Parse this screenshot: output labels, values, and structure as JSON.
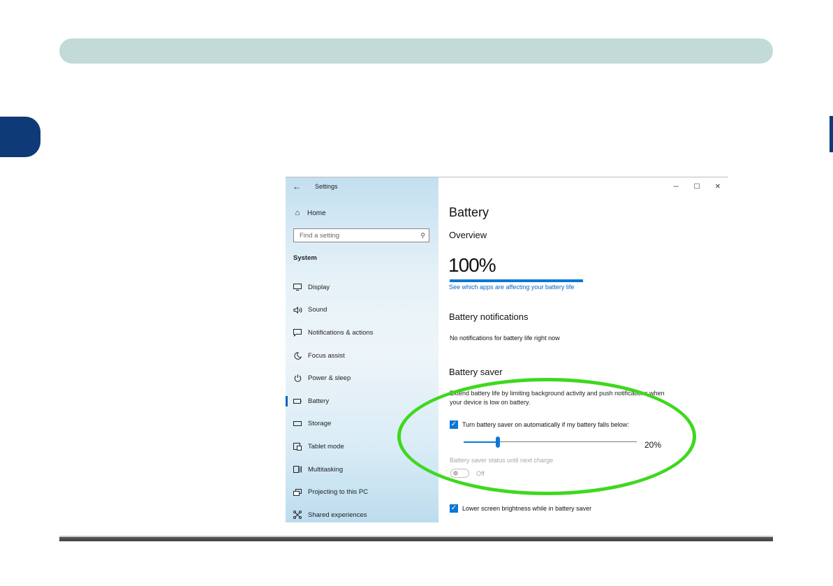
{
  "window": {
    "app_title": "Settings",
    "back_icon": "←",
    "minimize_icon": "─",
    "maximize_icon": "☐",
    "close_icon": "✕"
  },
  "nav": {
    "home_label": "Home",
    "home_icon": "⌂",
    "search": {
      "placeholder": "Find a setting",
      "value": "",
      "icon": "⚲"
    },
    "section_label": "System",
    "items": [
      {
        "label": "Display",
        "icon": "display-icon",
        "active": false
      },
      {
        "label": "Sound",
        "icon": "sound-icon",
        "active": false
      },
      {
        "label": "Notifications & actions",
        "icon": "notifications-icon",
        "active": false
      },
      {
        "label": "Focus assist",
        "icon": "focus-assist-icon",
        "active": false
      },
      {
        "label": "Power & sleep",
        "icon": "power-icon",
        "active": false
      },
      {
        "label": "Battery",
        "icon": "battery-icon",
        "active": true
      },
      {
        "label": "Storage",
        "icon": "storage-icon",
        "active": false
      },
      {
        "label": "Tablet mode",
        "icon": "tablet-mode-icon",
        "active": false
      },
      {
        "label": "Multitasking",
        "icon": "multitasking-icon",
        "active": false
      },
      {
        "label": "Projecting to this PC",
        "icon": "projecting-icon",
        "active": false
      },
      {
        "label": "Shared experiences",
        "icon": "shared-experiences-icon",
        "active": false
      }
    ]
  },
  "content": {
    "page_title": "Battery",
    "overview_heading": "Overview",
    "battery_percent_text": "100%",
    "battery_level": 1.0,
    "battery_link": "See which apps are affecting your battery life",
    "notifications_heading": "Battery notifications",
    "notifications_text": "No notifications for battery life right now",
    "saver_heading": "Battery saver",
    "saver_description": "Extend battery life by limiting background activity and push notifications when your device is low on battery.",
    "auto_saver": {
      "label": "Turn battery saver on automatically if my battery falls below:",
      "checked": true
    },
    "threshold_slider": {
      "value_text": "20%",
      "value": 0.2
    },
    "status_label": "Battery saver status until next charge",
    "status_toggle": {
      "label": "Off",
      "on": false
    },
    "lower_brightness": {
      "label": "Lower screen brightness while in battery saver",
      "checked": true
    }
  },
  "colors": {
    "accent": "#0b78d4",
    "highlight": "#3fd81f",
    "banner": "#c2dad8",
    "tab": "#0f3a78"
  }
}
